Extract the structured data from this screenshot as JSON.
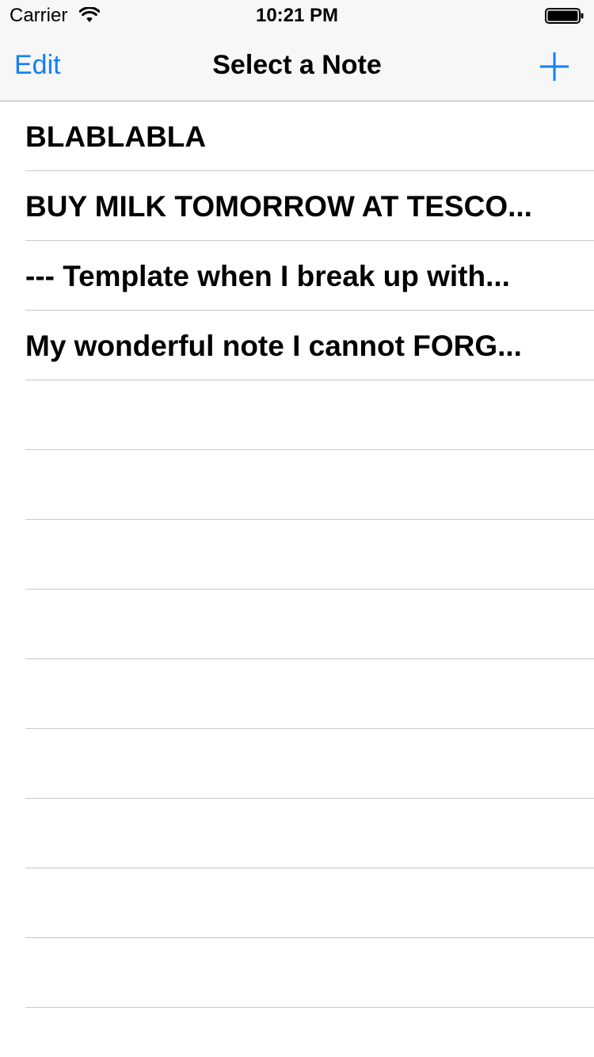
{
  "status_bar": {
    "carrier": "Carrier",
    "time": "10:21 PM",
    "wifi_icon": "wifi-icon",
    "battery_icon": "battery-full-icon"
  },
  "nav_bar": {
    "edit_label": "Edit",
    "title": "Select a Note",
    "add_icon": "plus-icon",
    "accent_color": "#157efb"
  },
  "notes": [
    {
      "title": "BLABLABLA"
    },
    {
      "title": "BUY MILK TOMORROW AT TESCO..."
    },
    {
      "title": "--- Template when I break up with..."
    },
    {
      "title": "My wonderful note I cannot FORG..."
    },
    {
      "title": ""
    },
    {
      "title": ""
    },
    {
      "title": ""
    },
    {
      "title": ""
    },
    {
      "title": ""
    },
    {
      "title": ""
    },
    {
      "title": ""
    },
    {
      "title": ""
    },
    {
      "title": ""
    },
    {
      "title": ""
    }
  ]
}
